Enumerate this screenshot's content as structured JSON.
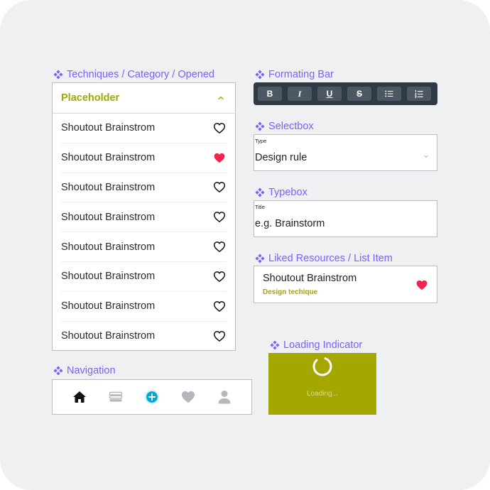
{
  "sections": {
    "techniques": "Techniques / Category / Opened",
    "navigation": "Navigation",
    "formatting": "Formating Bar",
    "selectbox": "Selectbox",
    "typebox": "Typebox",
    "liked": "Liked Resources / List Item",
    "loading": "Loading Indicator"
  },
  "techniques_list": {
    "placeholder": "Placeholder",
    "items": [
      {
        "label": "Shoutout Brainstrom",
        "liked": false
      },
      {
        "label": "Shoutout Brainstrom",
        "liked": true
      },
      {
        "label": "Shoutout Brainstrom",
        "liked": false
      },
      {
        "label": "Shoutout Brainstrom",
        "liked": false
      },
      {
        "label": "Shoutout Brainstrom",
        "liked": false
      },
      {
        "label": "Shoutout Brainstrom",
        "liked": false
      },
      {
        "label": "Shoutout Brainstrom",
        "liked": false
      },
      {
        "label": "Shoutout Brainstrom",
        "liked": false
      }
    ]
  },
  "navigation": {
    "items": [
      "home-icon",
      "library-icon",
      "add-icon",
      "heart-icon",
      "profile-icon"
    ],
    "active": "home-icon"
  },
  "formatting_bar": {
    "buttons": [
      {
        "label": "B",
        "icon": "bold-icon"
      },
      {
        "label": "I",
        "icon": "italic-icon"
      },
      {
        "label": "U",
        "icon": "underline-icon"
      },
      {
        "label": "S",
        "icon": "strikethrough-icon"
      },
      {
        "label": "",
        "icon": "bullet-list-icon"
      },
      {
        "label": "",
        "icon": "numbered-list-icon"
      }
    ]
  },
  "selectbox": {
    "label": "Type",
    "value": "Design rule"
  },
  "typebox": {
    "label": "Title",
    "placeholder": "e.g. Brainstorm"
  },
  "liked_item": {
    "title": "Shoutout Brainstrom",
    "subtitle": "Design techique",
    "liked": true
  },
  "loading": {
    "text": "Loading..."
  },
  "colors": {
    "accent_purple": "#7b61ff",
    "olive": "#a3a700",
    "heart_red": "#f0244e",
    "nav_add_cyan": "#00a7d6",
    "toolbar_dark": "#2f3a46"
  }
}
